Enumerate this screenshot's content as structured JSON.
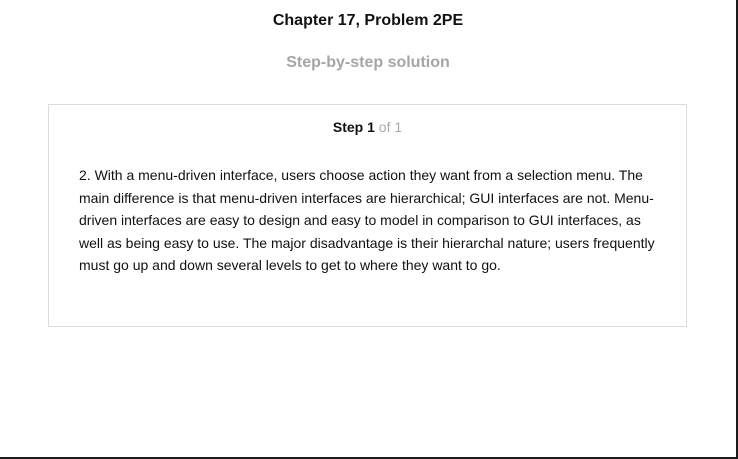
{
  "header": {
    "title": "Chapter 17, Problem 2PE",
    "subtitle": "Step-by-step solution"
  },
  "step": {
    "label": "Step",
    "number": "1",
    "total_text": "of 1",
    "body": "2. With a menu-driven interface, users choose action they want from a selection menu. The main difference is that menu-driven interfaces are hierarchical; GUI interfaces are not. Menu-driven interfaces are easy to design and easy to model in comparison to GUI interfaces, as well as being easy to use. The major disadvantage is their hierarchal nature; users frequently must go up and down several levels to get to where they want to go."
  }
}
